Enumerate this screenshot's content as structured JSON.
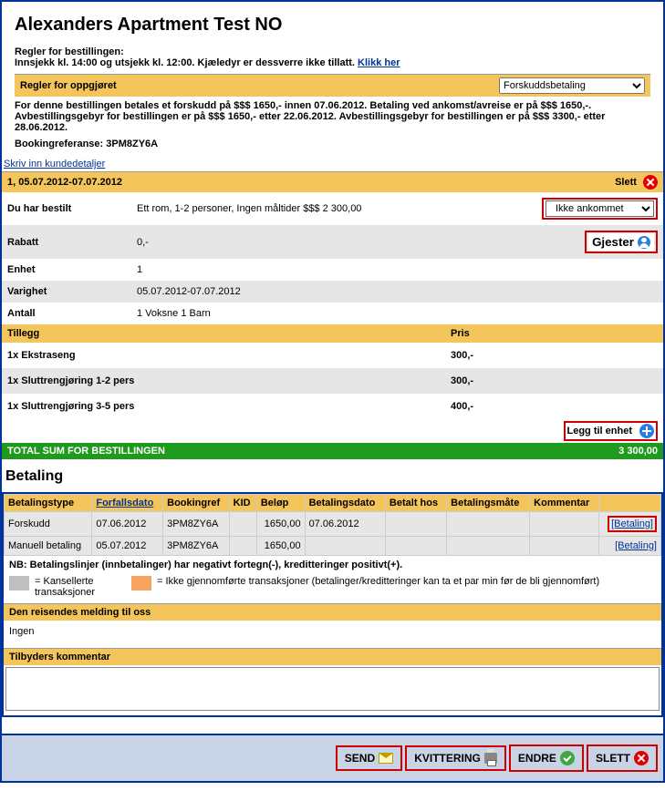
{
  "title": "Alexanders Apartment Test NO",
  "rules": {
    "heading": "Regler for bestillingen:",
    "text": "Innsjekk kl. 14:00 og utsjekk kl. 12:00. Kjæledyr er dessverre ikke tillatt.",
    "link": "Klikk her"
  },
  "settlement": {
    "heading": "Regler for oppgjøret",
    "selected": "Forskuddsbetaling",
    "body": "For denne bestillingen betales et forskudd på $$$ 1650,- innen 07.06.2012. Betaling ved ankomst/avreise er på $$$ 1650,-. Avbestillingsgebyr for bestillingen er på $$$ 1650,- etter 22.06.2012. Avbestillingsgebyr for bestillingen er på $$$ 3300,- etter 28.06.2012.",
    "ref_label": "Bookingreferanse:",
    "ref_value": "3PM8ZY6A",
    "customer_link": "Skriv inn kundedetaljer"
  },
  "booking": {
    "header": "1, 05.07.2012-07.07.2012",
    "slett": "Slett",
    "ordered_label": "Du har bestilt",
    "ordered_value": "Ett rom, 1-2 personer, Ingen måltider  $$$ 2 300,00",
    "status": "Ikke ankommet",
    "rabatt_label": "Rabatt",
    "rabatt_value": "0,-",
    "gjester": "Gjester",
    "enhet_label": "Enhet",
    "enhet_value": "1",
    "varighet_label": "Varighet",
    "varighet_value": "05.07.2012-07.07.2012",
    "antall_label": "Antall",
    "antall_value": "1 Voksne 1 Barn",
    "addons_header": {
      "tillegg": "Tillegg",
      "pris": "Pris"
    },
    "addons": [
      {
        "name": "1x Ekstraseng",
        "price": "300,-"
      },
      {
        "name": "1x Sluttrengjøring 1-2 pers",
        "price": "300,-"
      },
      {
        "name": "1x Sluttrengjøring 3-5 pers",
        "price": "400,-"
      }
    ],
    "add_unit": "Legg til enhet",
    "total_label": "TOTAL SUM FOR BESTILLINGEN",
    "total_value": "3 300,00"
  },
  "payment": {
    "heading": "Betaling",
    "headers": {
      "type": "Betalingstype",
      "due": "Forfallsdato",
      "ref": "Bookingref",
      "kid": "KID",
      "amount": "Beløp",
      "paydate": "Betalingsdato",
      "paidat": "Betalt hos",
      "method": "Betalingsmåte",
      "comment": "Kommentar",
      "action": ""
    },
    "rows": [
      {
        "type": "Forskudd",
        "due": "07.06.2012",
        "ref": "3PM8ZY6A",
        "kid": "",
        "amount": "1650,00",
        "paydate": "07.06.2012",
        "paidat": "",
        "method": "",
        "comment": "",
        "action": "[Betaling]"
      },
      {
        "type": "Manuell betaling",
        "due": "05.07.2012",
        "ref": "3PM8ZY6A",
        "kid": "",
        "amount": "1650,00",
        "paydate": "",
        "paidat": "",
        "method": "",
        "comment": "",
        "action": "[Betaling]"
      }
    ],
    "note": "NB: Betalingslinjer (innbetalinger) har negativt fortegn(-), kreditteringer positivt(+).",
    "legend1": "= Kansellerte transaksjoner",
    "legend2": "= Ikke gjennomførte transaksjoner (betalinger/kreditteringer kan ta et par min før de bli gjennomført)",
    "traveler_msg_label": "Den reisendes melding til oss",
    "traveler_msg_value": "Ingen",
    "provider_label": "Tilbyders kommentar"
  },
  "footer": {
    "send": "SEND",
    "kvittering": "KVITTERING",
    "endre": "ENDRE",
    "slett": "SLETT"
  }
}
